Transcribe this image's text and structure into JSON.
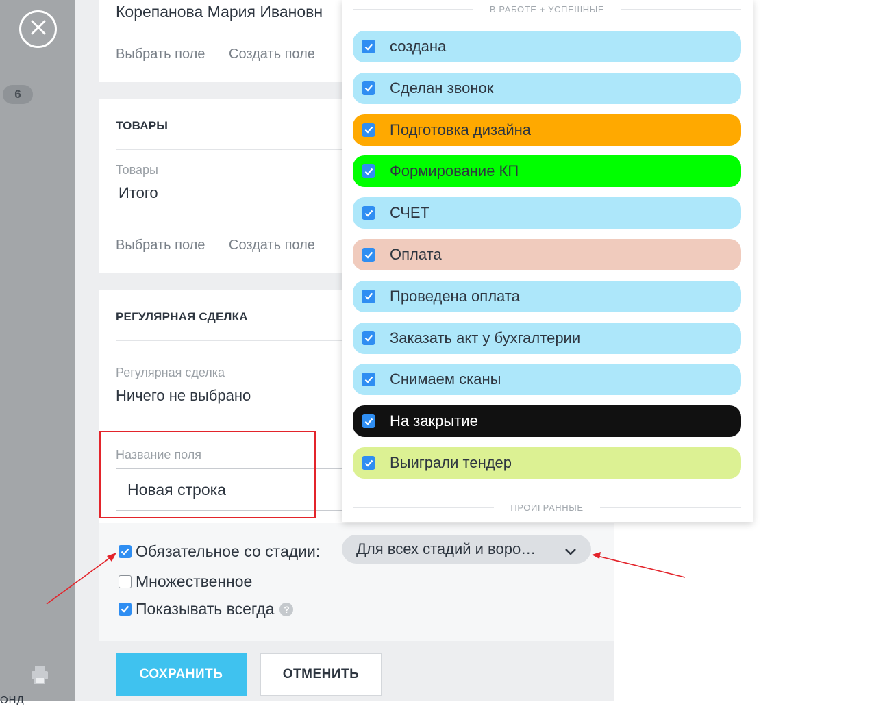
{
  "rail": {
    "badge": "6",
    "bottom_text": "ОНД"
  },
  "contact": {
    "name": "Корепанова Мария Ивановн",
    "select_field": "Выбрать поле",
    "create_field": "Создать поле"
  },
  "products": {
    "title": "ТОВАРЫ",
    "label": "Товары",
    "total": "Итого",
    "select_field": "Выбрать поле",
    "create_field": "Создать поле"
  },
  "regular": {
    "title": "РЕГУЛЯРНАЯ СДЕЛКА",
    "label": "Регулярная сделка",
    "value": "Ничего не выбрано"
  },
  "new_field": {
    "label": "Название поля",
    "value": "Новая строка"
  },
  "options": {
    "required_label": "Обязательное со стадии:",
    "required_checked": true,
    "stage_select": "Для всех стадий и воро…",
    "multiple_label": "Множественное",
    "multiple_checked": false,
    "always_label": "Показывать всегда",
    "always_checked": true,
    "help": "?"
  },
  "buttons": {
    "save": "СОХРАНИТЬ",
    "cancel": "ОТМЕНИТЬ"
  },
  "dropdown": {
    "group_active": "В РАБОТЕ + УСПЕШНЫЕ",
    "group_lost": "ПРОИГРАННЫЕ",
    "stages": [
      {
        "label": "создана",
        "color": "#ade7fa",
        "text_color": "#2e3640",
        "checked": true
      },
      {
        "label": "Сделан звонок",
        "color": "#ade7fa",
        "text_color": "#2e3640",
        "checked": true
      },
      {
        "label": "Подготовка дизайна",
        "color": "#ffa900",
        "text_color": "#2e3640",
        "checked": true
      },
      {
        "label": "Формирование КП",
        "color": "#00ff00",
        "text_color": "#2e3640",
        "checked": true
      },
      {
        "label": "СЧЕТ",
        "color": "#ade7fa",
        "text_color": "#2e3640",
        "checked": true
      },
      {
        "label": "Оплата",
        "color": "#f0cbbd",
        "text_color": "#2e3640",
        "checked": true
      },
      {
        "label": "Проведена оплата",
        "color": "#ade7fa",
        "text_color": "#2e3640",
        "checked": true
      },
      {
        "label": "Заказать акт у бухгалтерии",
        "color": "#ade7fa",
        "text_color": "#2e3640",
        "checked": true
      },
      {
        "label": "Снимаем сканы",
        "color": "#ade7fa",
        "text_color": "#2e3640",
        "checked": true
      },
      {
        "label": "На закрытие",
        "color": "#111111",
        "text_color": "#ffffff",
        "checked": true
      },
      {
        "label": "Выиграли тендер",
        "color": "#dcf193",
        "text_color": "#2e3640",
        "checked": true
      }
    ]
  },
  "colors": {
    "accent": "#3fc2ef",
    "checkbox": "#2f8ef2",
    "annotation_red": "#e3242b"
  }
}
